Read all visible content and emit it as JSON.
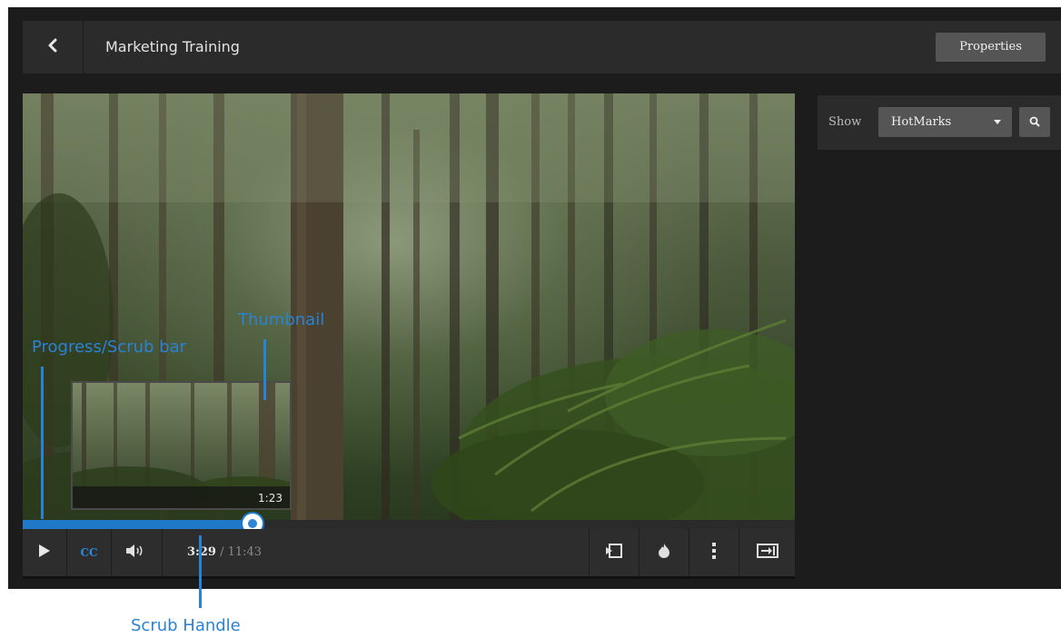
{
  "header": {
    "title": "Marketing Training",
    "properties_label": "Properties",
    "back_icon": "chevron-left-icon"
  },
  "side_panel": {
    "show_label": "Show",
    "filter_selected": "HotMarks",
    "search_icon": "search-icon"
  },
  "player": {
    "current_time": "3:29",
    "time_separator": "/",
    "total_time": "11:43",
    "cc_label": "CC",
    "progress_fraction": 0.298,
    "thumbnail_time": "1:23",
    "icons": [
      "play-icon",
      "cc-icon",
      "volume-icon",
      "chapters-icon",
      "hotmark-flame-icon",
      "more-vertical-icon",
      "exit-to-icon"
    ]
  },
  "annotations": {
    "progress": "Progress/Scrub bar",
    "thumbnail": "Thumbnail",
    "handle": "Scrub Handle"
  },
  "colors": {
    "accent": "#1f78c8",
    "annotation": "#2a82d4",
    "background": "#1c1c1c",
    "panel": "#2b2b2b",
    "button": "#555555"
  }
}
